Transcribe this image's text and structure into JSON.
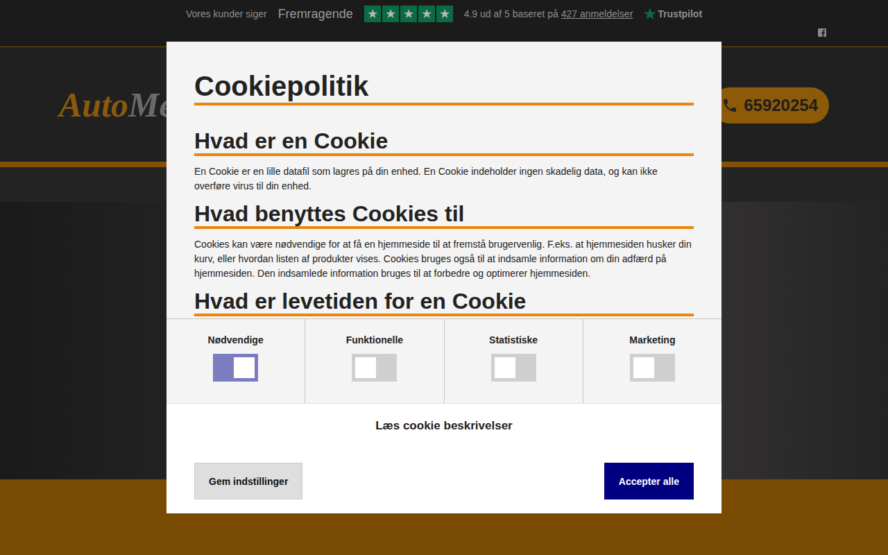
{
  "topbar": {
    "intro": "Vores kunder siger",
    "rating_word": "Fremragende",
    "stars": 5,
    "score_text": "4.9 ud af 5 baseret på",
    "reviews_link": "427 anmeldelser",
    "brand": "Trustpilot"
  },
  "header": {
    "logo": {
      "first": "Auto",
      "second": "Me"
    },
    "phone": "65920254"
  },
  "cookie_dialog": {
    "title": "Cookiepolitik",
    "sections": [
      {
        "heading": "Hvad er en Cookie",
        "body": "En Cookie er en lille datafil som lagres på din enhed. En Cookie indeholder ingen skadelig data, og kan ikke overføre virus til din enhed."
      },
      {
        "heading": "Hvad benyttes Cookies til",
        "body": "Cookies kan være nødvendige for at få en hjemmeside til at fremstå brugervenlig. F.eks. at hjemmesiden husker din kurv, eller hvordan listen af produkter vises. Cookies bruges også til at indsamle information om din adfærd på hjemmesiden. Den indsamlede information bruges til at forbedre og optimerer hjemmesiden."
      },
      {
        "heading": "Hvad er levetiden for en Cookie",
        "body": ""
      }
    ],
    "toggles": [
      {
        "label": "Nødvendige",
        "on": true
      },
      {
        "label": "Funktionelle",
        "on": false
      },
      {
        "label": "Statistiske",
        "on": false
      },
      {
        "label": "Marketing",
        "on": false
      }
    ],
    "details_link": "Læs cookie beskrivelser",
    "buttons": [
      {
        "label": "Gem indstillinger",
        "kind": "secondary"
      },
      {
        "label": "Accepter alle",
        "kind": "primary"
      }
    ]
  }
}
